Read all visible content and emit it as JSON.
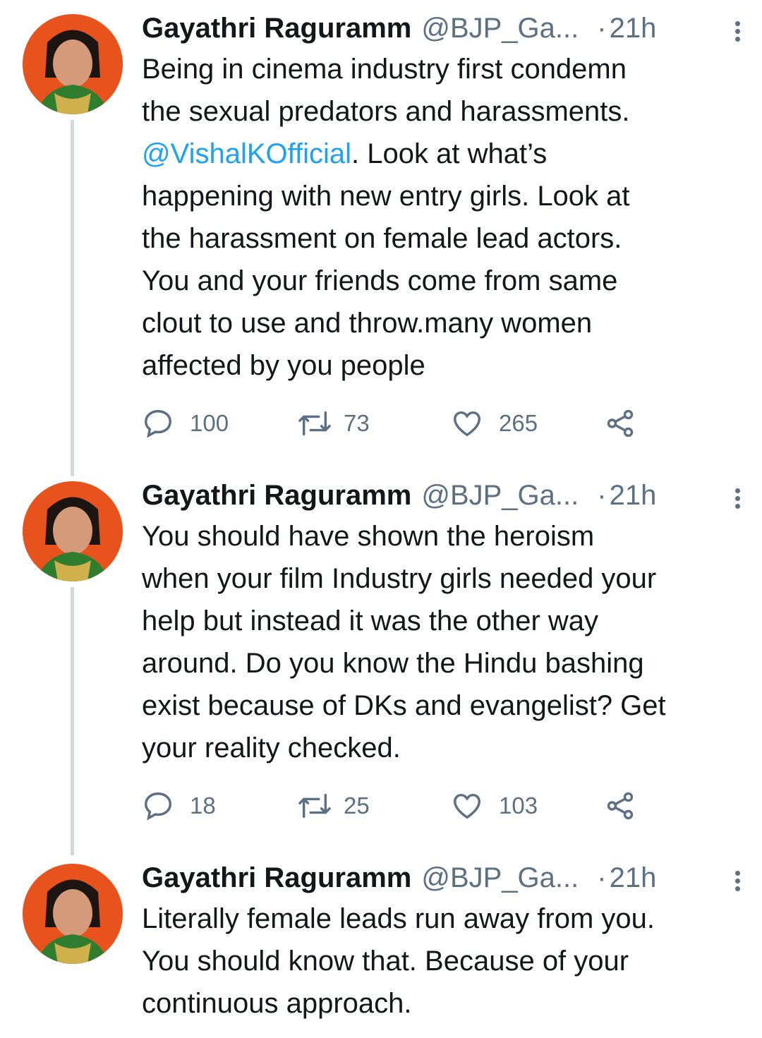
{
  "tweets": [
    {
      "name": "Gayathri Ragurамm",
      "handle": "@BJP_Ga...",
      "dot": "·",
      "time": "21h",
      "text_before": "Being in cinema industry first condemn\nthe sexual predators and harassments.\n",
      "mention": "@VishalKOfficial",
      "text_after": ". Look at what’s\nhappening with new entry girls. Look at\nthe harassment on female lead actors.\nYou and your friends come from same\nclout to use and throw.many women\naffected by you people",
      "replies": "100",
      "retweets": "73",
      "likes": "265"
    },
    {
      "name": "Gayathri Ragurамm",
      "handle": "@BJP_Ga...",
      "dot": "·",
      "time": "21h",
      "text": "You should have shown the heroism\nwhen your film Industry girls needed your\nhelp but instead it was the other way\naround. Do you know the Hindu bashing\nexist because of DKs and evangelist? Get\nyour reality checked.",
      "replies": "18",
      "retweets": "25",
      "likes": "103"
    },
    {
      "name": "Gayathri Ragurамm",
      "handle": "@BJP_Ga...",
      "dot": "·",
      "time": "21h",
      "text": "Literally female leads run away from you.\nYou should know that. Because of your\ncontinuous approach."
    }
  ],
  "colors": {
    "link": "#1da1f2",
    "muted": "#5b7083",
    "avatar_bg": "#e8531d"
  },
  "icons": [
    "reply-icon",
    "retweet-icon",
    "like-icon",
    "share-icon",
    "more-icon"
  ]
}
